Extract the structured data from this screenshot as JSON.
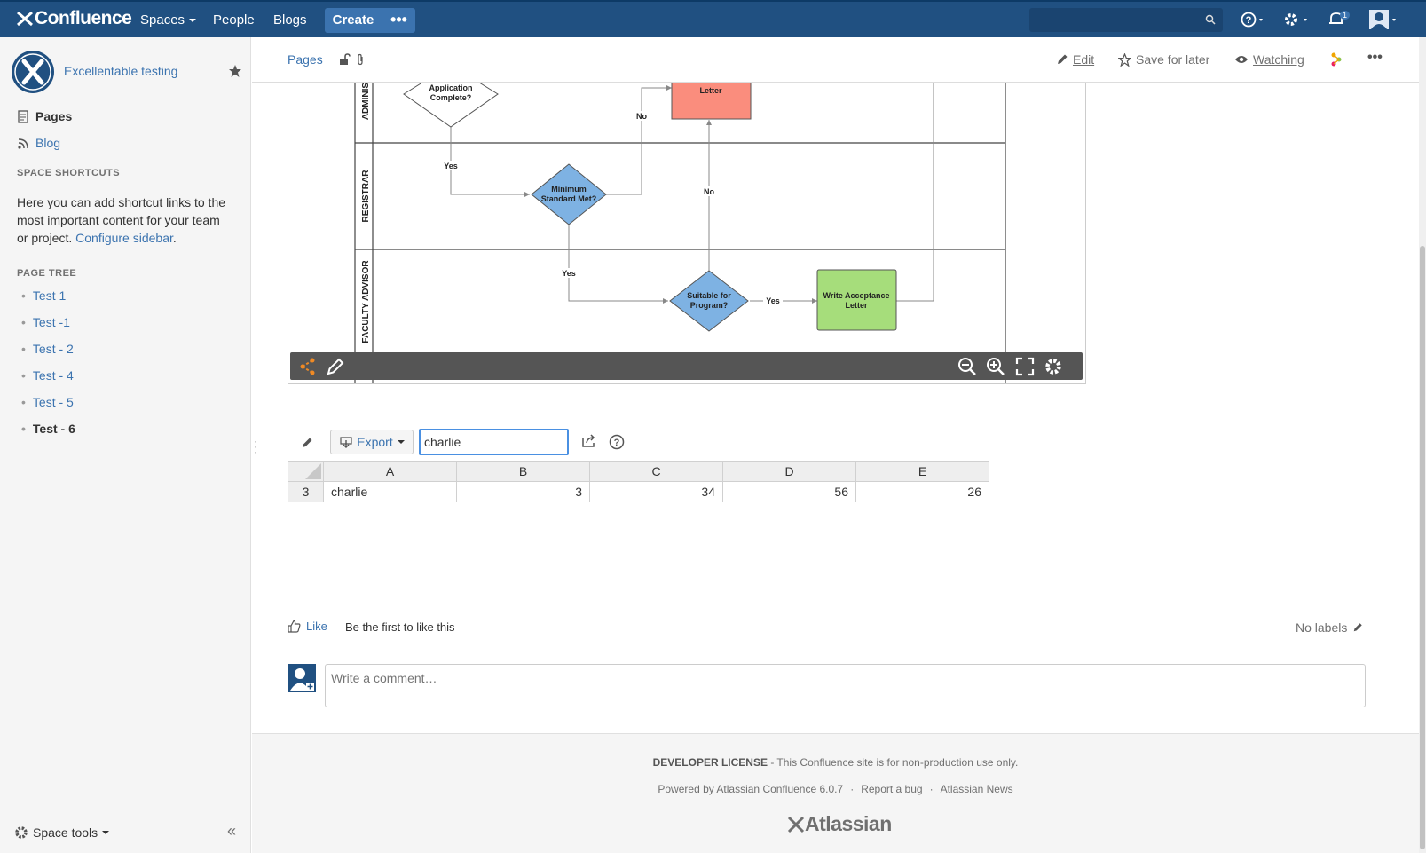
{
  "header": {
    "brand": "Confluence",
    "nav": [
      "Spaces",
      "People",
      "Blogs"
    ],
    "create_label": "Create",
    "more_label": "•••",
    "notification_count": "1",
    "search_placeholder": ""
  },
  "sidebar": {
    "space_name": "Excellentable testing",
    "pages_label": "Pages",
    "blog_label": "Blog",
    "shortcuts_heading": "SPACE SHORTCUTS",
    "shortcuts_text": "Here you can add shortcut links to the most important content for your team or project.",
    "configure_link": "Configure sidebar",
    "shortcuts_period": ".",
    "page_tree_heading": "PAGE TREE",
    "page_tree": [
      "Test 1",
      "Test -1",
      "Test - 2",
      "Test - 4",
      "Test - 5",
      "Test - 6"
    ],
    "current_page": "Test - 6",
    "space_tools_label": "Space tools",
    "collapse_label": "«"
  },
  "page_toolbar": {
    "breadcrumb": "Pages",
    "edit_label": "Edit",
    "save_later_label": "Save for later",
    "watching_label": "Watching",
    "more_label": "•••"
  },
  "diagram": {
    "lanes": [
      "ADMINIST",
      "REGISTRAR",
      "FACULTY ADVISOR"
    ],
    "nodes": {
      "app_complete": "Application Complete?",
      "rejection": "Write Rejection Letter",
      "min_standard": "Minimum Standard Met?",
      "suitable": "Suitable for Program?",
      "acceptance": "Write Acceptance Letter"
    },
    "edge_labels": {
      "yes": "Yes",
      "no": "No"
    },
    "colors": {
      "red": "#fa8d7d",
      "blue": "#7eb2e3",
      "green": "#a6dd7b",
      "toolbar": "#555555"
    }
  },
  "sheet": {
    "export_label": "Export",
    "search_value": "charlie",
    "columns": [
      "A",
      "B",
      "C",
      "D",
      "E"
    ],
    "rows": [
      {
        "header": "3",
        "cells": [
          "charlie",
          "3",
          "34",
          "56",
          "26"
        ]
      }
    ]
  },
  "social": {
    "like_label": "Like",
    "like_text": "Be the first to like this",
    "labels_text": "No labels",
    "comment_placeholder": "Write a comment…"
  },
  "footer": {
    "license_bold": "DEVELOPER LICENSE",
    "license_text": " - This Confluence site is for non-production use only.",
    "powered_by": "Powered by Atlassian Confluence 6.0.7",
    "report_bug": "Report a bug",
    "news": "Atlassian News",
    "separator": "·",
    "atlassian_logo": "Atlassian"
  }
}
